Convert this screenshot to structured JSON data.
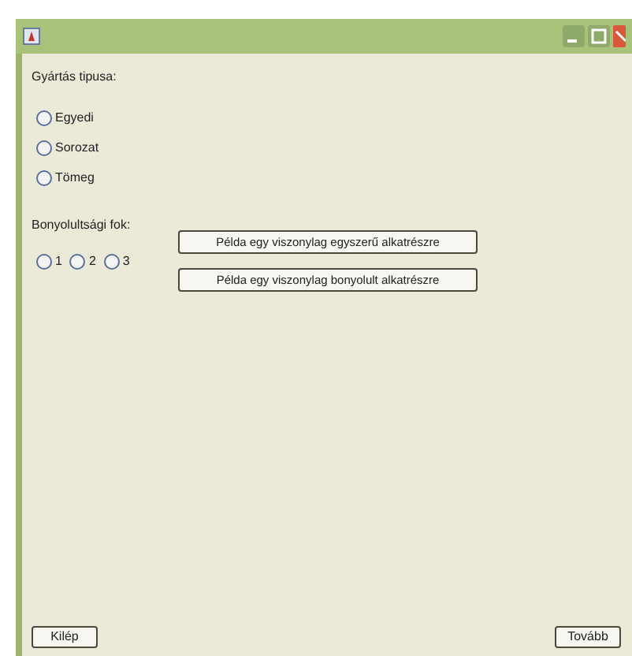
{
  "production_type": {
    "label": "Gyártás tipusa:",
    "options": [
      {
        "label": "Egyedi",
        "selected": false
      },
      {
        "label": "Sorozat",
        "selected": false
      },
      {
        "label": "Tömeg",
        "selected": false
      }
    ]
  },
  "complexity": {
    "label": "Bonyolultsági fok:",
    "options": [
      {
        "label": "1",
        "selected": false
      },
      {
        "label": "2",
        "selected": false
      },
      {
        "label": "3",
        "selected": false
      }
    ],
    "buttons": [
      "Példa egy viszonylag egyszerű alkatrészre",
      "Példa egy viszonylag bonyolult alkatrészre"
    ]
  },
  "footer": {
    "exit": "Kilép",
    "next": "Tovább"
  }
}
